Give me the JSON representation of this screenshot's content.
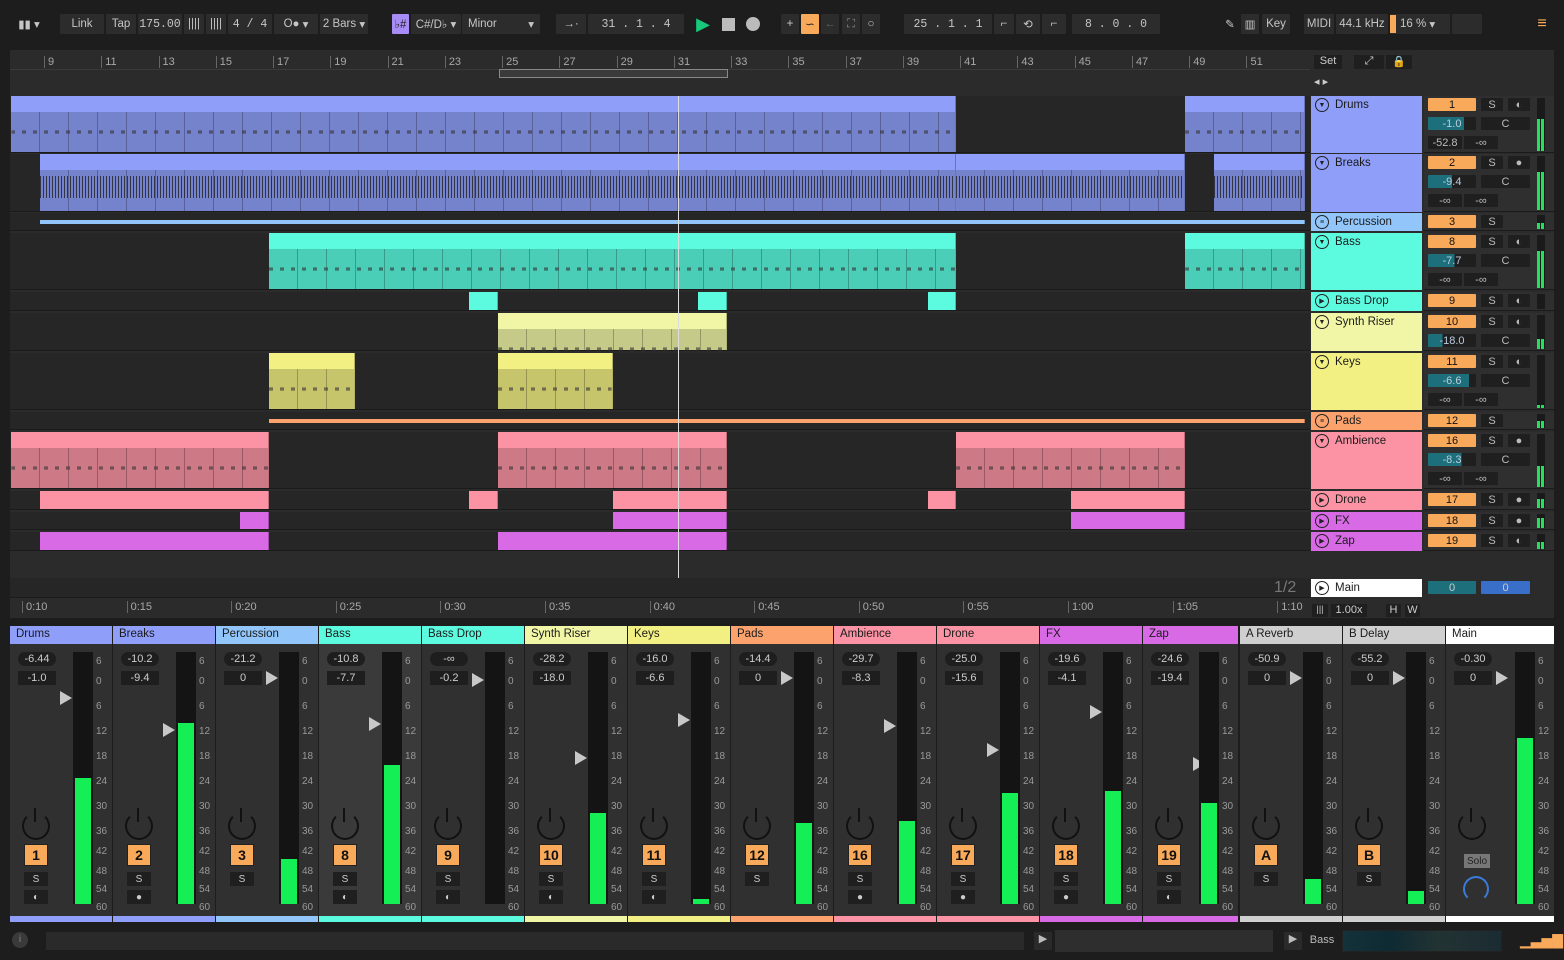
{
  "toolbar": {
    "link": "Link",
    "tap": "Tap",
    "tempo": "175.00",
    "signature": "4 / 4",
    "metronome": "O●",
    "quantize": "2 Bars",
    "key": "C#/D♭",
    "scale": "Minor",
    "position": "31 .  1 .  4",
    "loop_start": "25 .  1 .  1",
    "loop_length": "8 .  0 .  0",
    "key_map": "Key",
    "midi_map": "MIDI",
    "sample_rate": "44.1 kHz",
    "cpu": "16 %",
    "accent": "#f9a95a",
    "play_color": "#17c97a"
  },
  "ruler": {
    "bars": [
      "9",
      "11",
      "13",
      "15",
      "17",
      "19",
      "21",
      "23",
      "25",
      "27",
      "29",
      "31",
      "33",
      "35",
      "37",
      "39",
      "41",
      "43",
      "45",
      "47",
      "49",
      "51"
    ],
    "time": [
      "0:10",
      "0:15",
      "0:20",
      "0:25",
      "0:30",
      "0:35",
      "0:40",
      "0:45",
      "0:50",
      "0:55",
      "1:00",
      "1:05",
      "1:10"
    ]
  },
  "set_button": "Set",
  "page_indicator": "1/2",
  "zoom_bar": {
    "speed": "1.00x",
    "h": "H",
    "w": "W"
  },
  "tracks": [
    {
      "name": "Drums",
      "color": "#8f9ef9",
      "fold": "down",
      "num": "1",
      "vol": "-1.0",
      "vol_fill": 0.75,
      "pan": "C",
      "sendA": "-52.8",
      "sendB": "-∞",
      "arm": "◐",
      "meter": 0.6,
      "clips": [
        [
          8,
          41
        ],
        [
          49,
          53.2
        ]
      ]
    },
    {
      "name": "Breaks",
      "color": "#8f9ef9",
      "fold": "down",
      "num": "2",
      "vol": "-9.4",
      "vol_fill": 0.5,
      "pan": "C",
      "sendA": "-∞",
      "sendB": "-∞",
      "arm": "●",
      "meter": 0.7,
      "clips": [
        [
          9,
          41
        ],
        [
          41,
          49
        ],
        [
          50,
          53.2
        ]
      ]
    },
    {
      "name": "Percussion",
      "color": "#92c6fb",
      "fold": "group",
      "num": "3",
      "meter": 0.4,
      "clips": []
    },
    {
      "name": "Bass",
      "color": "#5cfbe0",
      "fold": "down",
      "num": "8",
      "vol": "-7.7",
      "vol_fill": 0.55,
      "pan": "C",
      "sendA": "-∞",
      "sendB": "-∞",
      "arm": "◐",
      "meter": 0.7,
      "clips": [
        [
          17,
          41
        ],
        [
          49,
          53.2
        ]
      ]
    },
    {
      "name": "Bass Drop",
      "color": "#5cfbe0",
      "fold": "play",
      "num": "9",
      "arm": "◐",
      "meter": 0,
      "clips": [
        [
          24,
          25
        ],
        [
          32,
          33
        ],
        [
          40,
          41
        ]
      ]
    },
    {
      "name": "Synth Riser",
      "color": "#f1f6a6",
      "fold": "down",
      "num": "10",
      "vol": "-18.0",
      "vol_fill": 0.3,
      "pan": "C",
      "arm": "◐",
      "meter": 0.3,
      "clips": [
        [
          25,
          33
        ]
      ]
    },
    {
      "name": "Keys",
      "color": "#f3f083",
      "fold": "down",
      "num": "11",
      "vol": "-6.6",
      "vol_fill": 0.85,
      "pan": "C",
      "sendA": "-∞",
      "sendB": "-∞",
      "arm": "◐",
      "meter": 0.05,
      "clips": [
        [
          17,
          20
        ],
        [
          25,
          29
        ]
      ]
    },
    {
      "name": "Pads",
      "color": "#fca36d",
      "fold": "group",
      "num": "12",
      "meter": 0.5,
      "clips": []
    },
    {
      "name": "Ambience",
      "color": "#fb93a4",
      "fold": "down",
      "num": "16",
      "vol": "-8.3",
      "vol_fill": 0.7,
      "pan": "C",
      "sendA": "-∞",
      "sendB": "-∞",
      "arm": "●",
      "meter": 0.4,
      "clips": [
        [
          8,
          17
        ],
        [
          25,
          33
        ],
        [
          41,
          49
        ]
      ]
    },
    {
      "name": "Drone",
      "color": "#fb93a4",
      "fold": "play",
      "num": "17",
      "arm": "●",
      "meter": 0.6,
      "clips": [
        [
          9,
          17
        ],
        [
          24,
          25
        ],
        [
          29,
          33
        ],
        [
          40,
          41
        ],
        [
          45,
          49
        ]
      ]
    },
    {
      "name": "FX",
      "color": "#d86ae6",
      "fold": "play",
      "num": "18",
      "arm": "●",
      "meter": 0.7,
      "clips": [
        [
          16,
          17
        ],
        [
          29,
          33
        ],
        [
          45,
          49
        ]
      ]
    },
    {
      "name": "Zap",
      "color": "#d86ae6",
      "fold": "play",
      "num": "19",
      "arm": "◐",
      "meter": 0.5,
      "clips": [
        [
          9,
          17
        ],
        [
          25,
          33
        ]
      ]
    }
  ],
  "main_track": {
    "name": "Main",
    "color": "#ffffff",
    "vol": "0",
    "cue": "0"
  },
  "mixer": [
    {
      "name": "Drums",
      "color": "#8f9ef9",
      "peak": "-6.44",
      "vol": "-1.0",
      "num": "1",
      "arm": "◐",
      "meter": 0.5,
      "fader": 0.1
    },
    {
      "name": "Breaks",
      "color": "#8f9ef9",
      "peak": "-10.2",
      "vol": "-9.4",
      "num": "2",
      "arm": "●",
      "meter": 0.72,
      "fader": 0.26
    },
    {
      "name": "Percussion",
      "color": "#92c6fb",
      "peak": "-21.2",
      "vol": "0",
      "num": "3",
      "meter": 0.18,
      "fader": 0.0
    },
    {
      "name": "Bass",
      "color": "#5cfbe0",
      "peak": "-10.8",
      "vol": "-7.7",
      "num": "8",
      "arm": "◐",
      "meter": 0.55,
      "fader": 0.23
    },
    {
      "name": "Bass Drop",
      "color": "#5cfbe0",
      "peak": "-∞",
      "vol": "-0.2",
      "num": "9",
      "arm": "◐",
      "meter": 0,
      "fader": 0.01
    },
    {
      "name": "Synth Riser",
      "color": "#f1f6a6",
      "peak": "-28.2",
      "vol": "-18.0",
      "num": "10",
      "arm": "◐",
      "meter": 0.36,
      "fader": 0.4
    },
    {
      "name": "Keys",
      "color": "#f3f083",
      "peak": "-16.0",
      "vol": "-6.6",
      "num": "11",
      "arm": "◐",
      "meter": 0.02,
      "fader": 0.21
    },
    {
      "name": "Pads",
      "color": "#fca36d",
      "peak": "-14.4",
      "vol": "0",
      "num": "12",
      "meter": 0.32,
      "fader": 0.0
    },
    {
      "name": "Ambience",
      "color": "#fb93a4",
      "peak": "-29.7",
      "vol": "-8.3",
      "num": "16",
      "arm": "●",
      "meter": 0.33,
      "fader": 0.24
    },
    {
      "name": "Drone",
      "color": "#fb93a4",
      "peak": "-25.0",
      "vol": "-15.6",
      "num": "17",
      "arm": "●",
      "meter": 0.44,
      "fader": 0.36
    },
    {
      "name": "FX",
      "color": "#d86ae6",
      "peak": "-19.6",
      "vol": "-4.1",
      "num": "18",
      "arm": "●",
      "meter": 0.45,
      "fader": 0.17
    },
    {
      "name": "Zap",
      "color": "#d86ae6",
      "peak": "-24.6",
      "vol": "-19.4",
      "num": "19",
      "arm": "◐",
      "meter": 0.4,
      "fader": 0.43
    },
    {
      "name": "A Reverb",
      "color": "#cfcfcf",
      "peak": "-50.9",
      "vol": "0",
      "num": "A",
      "meter": 0.1,
      "fader": 0.0
    },
    {
      "name": "B Delay",
      "color": "#cfcfcf",
      "peak": "-55.2",
      "vol": "0",
      "num": "B",
      "meter": 0.05,
      "fader": 0.0
    },
    {
      "name": "Main",
      "color": "#ffffff",
      "peak": "-0.30",
      "vol": "0",
      "solo": "Solo",
      "meter": 0.66,
      "fader": 0.0
    }
  ],
  "meter_scale": [
    "6",
    "0",
    "6",
    "12",
    "18",
    "24",
    "30",
    "36",
    "42",
    "48",
    "54",
    "60"
  ],
  "statusbar": {
    "selected_track": "Bass"
  }
}
